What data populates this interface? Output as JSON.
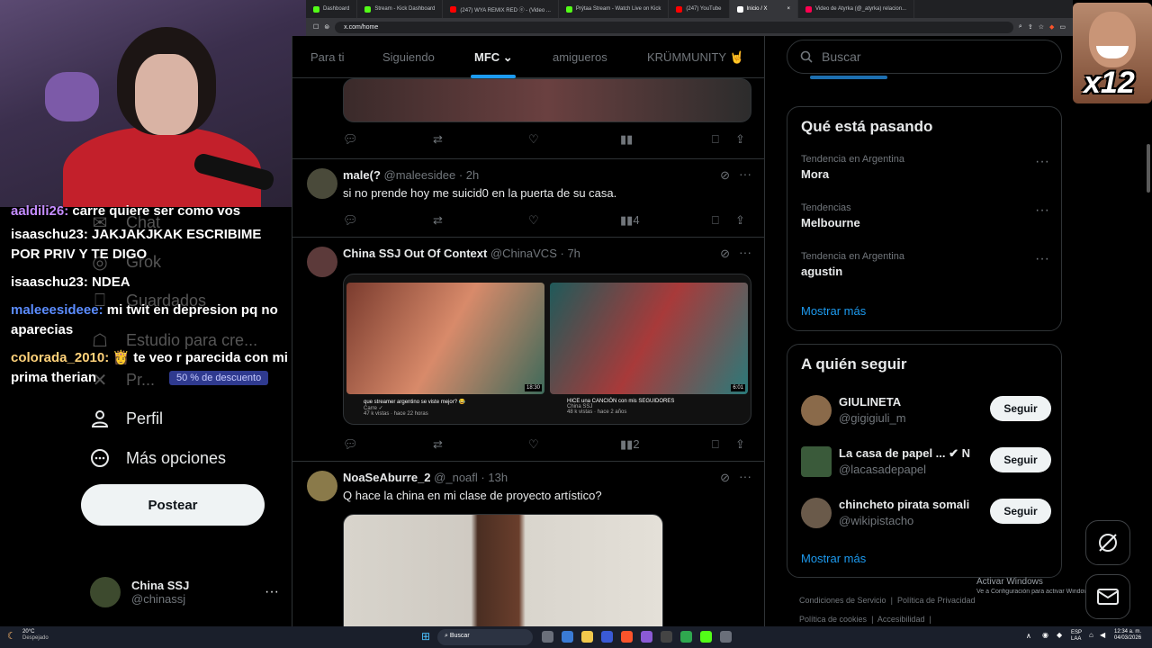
{
  "browser": {
    "tabs": [
      {
        "label": "Dashboard",
        "color": "#53fc18"
      },
      {
        "label": "Stream - Kick Dashboard",
        "color": "#53fc18"
      },
      {
        "label": "(247) WYA REMIX RED ⓔ - (Video ...",
        "color": "#ff0000"
      },
      {
        "label": "Prýtaa Stream - Watch Live on Kick",
        "color": "#53fc18"
      },
      {
        "label": "(247) YouTube",
        "color": "#ff0000"
      },
      {
        "label": "Inicio / X",
        "color": "#ffffff",
        "active": true
      },
      {
        "label": "Video de Atyrka (@_atyrka) relacion...",
        "color": "#ff0050"
      }
    ],
    "url": "x.com/home"
  },
  "chat": {
    "lines": [
      {
        "user": "aaldili26:",
        "msg": " carre quiere ser como vos",
        "color": "#c48cff"
      },
      {
        "user": "isaaschu23:",
        "msg": " JAKJAKJKAK ESCRIBIME POR PRIV Y TE DIGO",
        "color": "#ffffff"
      },
      {
        "user": "isaaschu23:",
        "msg": " NDEA",
        "color": "#ffffff"
      },
      {
        "user": "maleeesideee:",
        "msg": " mi twit en depresion pq no aparecias",
        "color": "#5b8cff"
      },
      {
        "user": "colorada_2010:",
        "msg": " 👸 te veo r parecida con mi prima therian",
        "color": "#ffd27a"
      }
    ],
    "discount_badge": "50 % de descuento"
  },
  "nav": {
    "items": [
      {
        "label": "Chat",
        "icon": "chat-icon"
      },
      {
        "label": "Grok",
        "icon": "grok-icon"
      },
      {
        "label": "Guardados",
        "icon": "bookmark-icon"
      },
      {
        "label": "Estudio para cre...",
        "icon": "studio-icon"
      },
      {
        "label": "Pr...",
        "icon": "premium-icon"
      },
      {
        "label": "Perfil",
        "icon": "profile-icon"
      },
      {
        "label": "Más opciones",
        "icon": "more-options-icon"
      }
    ],
    "post_button": "Postear",
    "account": {
      "name": "China SSJ",
      "handle": "@chinassj"
    }
  },
  "timeline": {
    "tabs": [
      "Para ti",
      "Siguiendo",
      "MFC",
      "amigueros",
      "KRÜMMUNITY 🤘"
    ],
    "selected_tab": "MFC",
    "posts": [
      {
        "name": "male(?",
        "handle": "@maleesidee",
        "time": "· 2h",
        "text": "si no prende hoy me suicid0 en la puerta de su casa.",
        "views": "4"
      },
      {
        "name": "China SSJ Out Of Context",
        "handle": "@ChinaVCS",
        "time": "· 7h",
        "text": "",
        "views": "2",
        "videos": [
          {
            "title": "que streamer argentino se viste mejor? 😂",
            "channel": "Carre ✓",
            "meta": "47 k vistas · hace 22 horas",
            "duration": "18:30"
          },
          {
            "title": "HICE una CANCIÓN con mis SEGUIDORES",
            "channel": "China SSJ",
            "meta": "48 k vistas · hace 2 años",
            "duration": "6:01"
          }
        ]
      },
      {
        "name": "NoaSeAburre_2",
        "handle": "@_noafl",
        "time": "· 13h",
        "text": "Q hace la china en mi clase de proyecto artístico?",
        "views": ""
      }
    ]
  },
  "search": {
    "placeholder": "Buscar"
  },
  "trends": {
    "title": "Qué está pasando",
    "items": [
      {
        "context": "Tendencia en Argentina",
        "topic": "Mora"
      },
      {
        "context": "Tendencias",
        "topic": "Melbourne"
      },
      {
        "context": "Tendencia en Argentina",
        "topic": "agustin"
      }
    ],
    "show_more": "Mostrar más"
  },
  "who_to_follow": {
    "title": "A quién seguir",
    "items": [
      {
        "name": "GIULINETA",
        "handle": "@gigigiuli_m",
        "button": "Seguir"
      },
      {
        "name": "La casa de papel ... ✔ N",
        "handle": "@lacasadepapel",
        "button": "Seguir"
      },
      {
        "name": "chincheto pirata somali",
        "handle": "@wikipistacho",
        "button": "Seguir"
      }
    ],
    "show_more": "Mostrar más"
  },
  "footer": {
    "links": [
      "Condiciones de Servicio",
      "|",
      "Política de Privacidad",
      "Política de cookies",
      "|",
      "Accesibilidad",
      "|"
    ],
    "watermark_title": "Activar Windows",
    "watermark_sub": "Ve a Configuración para activar Windows."
  },
  "emote": {
    "label": "x12"
  },
  "taskbar": {
    "weather_temp": "20°C",
    "weather_text": "Despejado",
    "search": "Buscar",
    "lang": "ESP",
    "lang2": "LAA",
    "time": "12:34 a. m.",
    "date": "04/03/2026"
  }
}
